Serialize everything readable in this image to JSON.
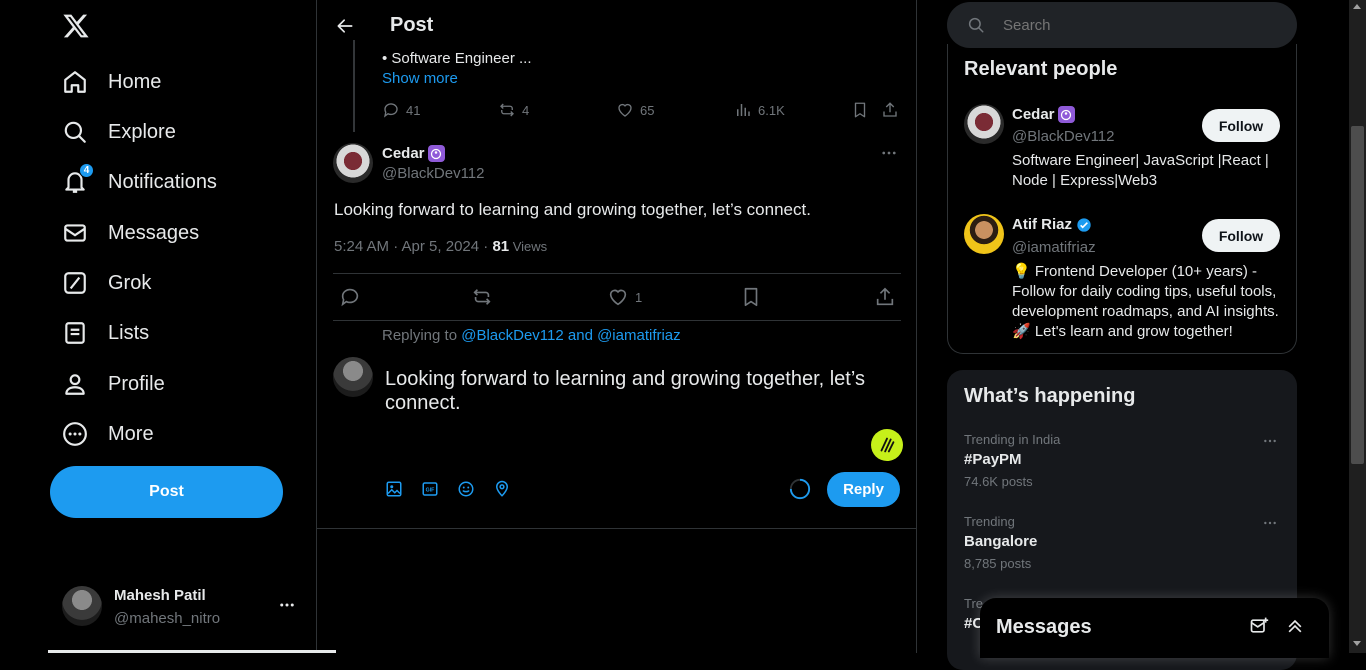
{
  "nav": {
    "items": [
      {
        "label": "Home"
      },
      {
        "label": "Explore"
      },
      {
        "label": "Notifications",
        "badge": "4"
      },
      {
        "label": "Messages"
      },
      {
        "label": "Grok"
      },
      {
        "label": "Lists"
      },
      {
        "label": "Profile"
      },
      {
        "label": "More"
      }
    ],
    "post_button": "Post"
  },
  "account": {
    "name": "Mahesh Patil",
    "handle": "@mahesh_nitro"
  },
  "header": {
    "title": "Post"
  },
  "parent_post": {
    "bio_line": "• Software Engineer ...",
    "show_more": "Show more",
    "replies": "41",
    "reposts": "4",
    "likes": "65",
    "views": "6.1K"
  },
  "main_post": {
    "name": "Cedar",
    "handle": "@BlackDev112",
    "text": "Looking forward to learning and growing together, let’s connect.",
    "timestamp": "5:24 AM · Apr 5, 2024 · ",
    "views_count": "81",
    "views_label": " Views",
    "likes": "1"
  },
  "reply_box": {
    "replying_to_prefix": "Replying to ",
    "replying_to_handles": "@BlackDev112 and @iamatifriaz",
    "draft": "Looking forward to learning and growing together, let’s connect.",
    "reply_button": "Reply"
  },
  "search": {
    "placeholder": "Search"
  },
  "relevant": {
    "title": "Relevant people",
    "people": [
      {
        "name": "Cedar",
        "handle": "@BlackDev112",
        "bio": "Software Engineer| JavaScript |React | Node | Express|Web3",
        "follow": "Follow"
      },
      {
        "name": "Atif Riaz",
        "handle": "@iamatifriaz",
        "bio": "💡 Frontend Developer (10+ years) - Follow for daily coding tips, useful tools, development roadmaps, and AI insights. 🚀 Let's learn and grow together!",
        "follow": "Follow"
      }
    ]
  },
  "happening": {
    "title": "What’s happening",
    "trends": [
      {
        "category": "Trending in India",
        "name": "#PayPM",
        "count": "74.6K posts"
      },
      {
        "category": "Trending",
        "name": "Bangalore",
        "count": "8,785 posts"
      },
      {
        "category": "Tre",
        "name": "#C",
        "count": ""
      }
    ]
  },
  "messages_drawer": {
    "title": "Messages"
  },
  "colors": {
    "accent": "#1d9bf0",
    "background": "#000000",
    "border": "#2f3336",
    "muted": "#71767b",
    "panel": "#16181c"
  }
}
